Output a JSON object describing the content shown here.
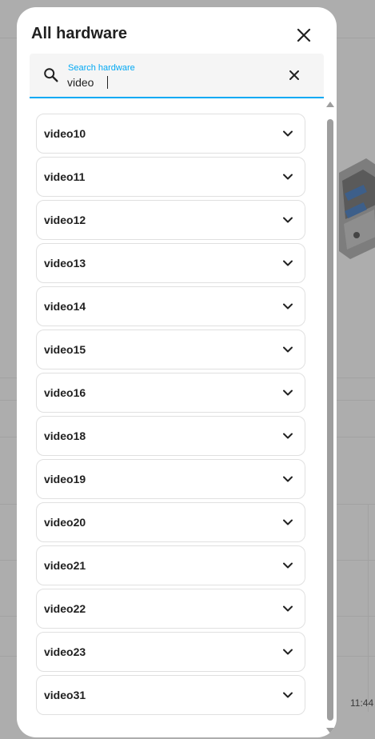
{
  "dialog": {
    "title": "All hardware"
  },
  "search": {
    "label": "Search hardware",
    "value": "video"
  },
  "hardware_items": [
    {
      "label": "video10"
    },
    {
      "label": "video11"
    },
    {
      "label": "video12"
    },
    {
      "label": "video13"
    },
    {
      "label": "video14"
    },
    {
      "label": "video15"
    },
    {
      "label": "video16"
    },
    {
      "label": "video18"
    },
    {
      "label": "video19"
    },
    {
      "label": "video20"
    },
    {
      "label": "video21"
    },
    {
      "label": "video22"
    },
    {
      "label": "video23"
    },
    {
      "label": "video31"
    }
  ],
  "background": {
    "time": "11:44"
  },
  "colors": {
    "accent": "#03a9f4",
    "overlay": "#adadad"
  },
  "icons": {
    "close": "close-icon",
    "search": "magnify-icon",
    "clear": "clear-icon",
    "expand": "chevron-down-icon"
  }
}
